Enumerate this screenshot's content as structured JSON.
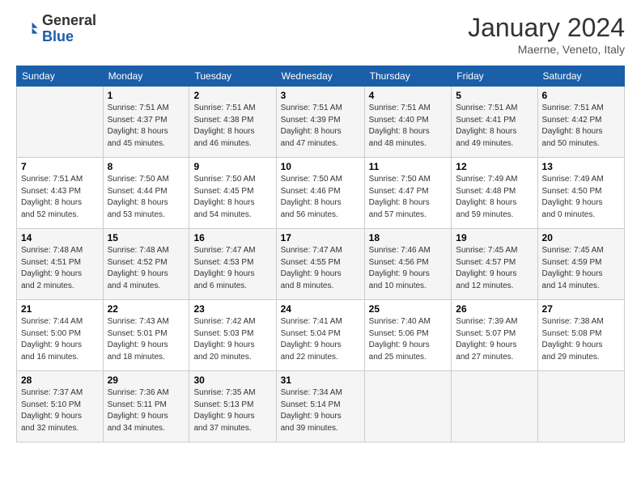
{
  "header": {
    "logo_general": "General",
    "logo_blue": "Blue",
    "month_title": "January 2024",
    "subtitle": "Maerne, Veneto, Italy"
  },
  "weekdays": [
    "Sunday",
    "Monday",
    "Tuesday",
    "Wednesday",
    "Thursday",
    "Friday",
    "Saturday"
  ],
  "weeks": [
    [
      {
        "day": "",
        "info": ""
      },
      {
        "day": "1",
        "info": "Sunrise: 7:51 AM\nSunset: 4:37 PM\nDaylight: 8 hours\nand 45 minutes."
      },
      {
        "day": "2",
        "info": "Sunrise: 7:51 AM\nSunset: 4:38 PM\nDaylight: 8 hours\nand 46 minutes."
      },
      {
        "day": "3",
        "info": "Sunrise: 7:51 AM\nSunset: 4:39 PM\nDaylight: 8 hours\nand 47 minutes."
      },
      {
        "day": "4",
        "info": "Sunrise: 7:51 AM\nSunset: 4:40 PM\nDaylight: 8 hours\nand 48 minutes."
      },
      {
        "day": "5",
        "info": "Sunrise: 7:51 AM\nSunset: 4:41 PM\nDaylight: 8 hours\nand 49 minutes."
      },
      {
        "day": "6",
        "info": "Sunrise: 7:51 AM\nSunset: 4:42 PM\nDaylight: 8 hours\nand 50 minutes."
      }
    ],
    [
      {
        "day": "7",
        "info": "Sunrise: 7:51 AM\nSunset: 4:43 PM\nDaylight: 8 hours\nand 52 minutes."
      },
      {
        "day": "8",
        "info": "Sunrise: 7:50 AM\nSunset: 4:44 PM\nDaylight: 8 hours\nand 53 minutes."
      },
      {
        "day": "9",
        "info": "Sunrise: 7:50 AM\nSunset: 4:45 PM\nDaylight: 8 hours\nand 54 minutes."
      },
      {
        "day": "10",
        "info": "Sunrise: 7:50 AM\nSunset: 4:46 PM\nDaylight: 8 hours\nand 56 minutes."
      },
      {
        "day": "11",
        "info": "Sunrise: 7:50 AM\nSunset: 4:47 PM\nDaylight: 8 hours\nand 57 minutes."
      },
      {
        "day": "12",
        "info": "Sunrise: 7:49 AM\nSunset: 4:48 PM\nDaylight: 8 hours\nand 59 minutes."
      },
      {
        "day": "13",
        "info": "Sunrise: 7:49 AM\nSunset: 4:50 PM\nDaylight: 9 hours\nand 0 minutes."
      }
    ],
    [
      {
        "day": "14",
        "info": "Sunrise: 7:48 AM\nSunset: 4:51 PM\nDaylight: 9 hours\nand 2 minutes."
      },
      {
        "day": "15",
        "info": "Sunrise: 7:48 AM\nSunset: 4:52 PM\nDaylight: 9 hours\nand 4 minutes."
      },
      {
        "day": "16",
        "info": "Sunrise: 7:47 AM\nSunset: 4:53 PM\nDaylight: 9 hours\nand 6 minutes."
      },
      {
        "day": "17",
        "info": "Sunrise: 7:47 AM\nSunset: 4:55 PM\nDaylight: 9 hours\nand 8 minutes."
      },
      {
        "day": "18",
        "info": "Sunrise: 7:46 AM\nSunset: 4:56 PM\nDaylight: 9 hours\nand 10 minutes."
      },
      {
        "day": "19",
        "info": "Sunrise: 7:45 AM\nSunset: 4:57 PM\nDaylight: 9 hours\nand 12 minutes."
      },
      {
        "day": "20",
        "info": "Sunrise: 7:45 AM\nSunset: 4:59 PM\nDaylight: 9 hours\nand 14 minutes."
      }
    ],
    [
      {
        "day": "21",
        "info": "Sunrise: 7:44 AM\nSunset: 5:00 PM\nDaylight: 9 hours\nand 16 minutes."
      },
      {
        "day": "22",
        "info": "Sunrise: 7:43 AM\nSunset: 5:01 PM\nDaylight: 9 hours\nand 18 minutes."
      },
      {
        "day": "23",
        "info": "Sunrise: 7:42 AM\nSunset: 5:03 PM\nDaylight: 9 hours\nand 20 minutes."
      },
      {
        "day": "24",
        "info": "Sunrise: 7:41 AM\nSunset: 5:04 PM\nDaylight: 9 hours\nand 22 minutes."
      },
      {
        "day": "25",
        "info": "Sunrise: 7:40 AM\nSunset: 5:06 PM\nDaylight: 9 hours\nand 25 minutes."
      },
      {
        "day": "26",
        "info": "Sunrise: 7:39 AM\nSunset: 5:07 PM\nDaylight: 9 hours\nand 27 minutes."
      },
      {
        "day": "27",
        "info": "Sunrise: 7:38 AM\nSunset: 5:08 PM\nDaylight: 9 hours\nand 29 minutes."
      }
    ],
    [
      {
        "day": "28",
        "info": "Sunrise: 7:37 AM\nSunset: 5:10 PM\nDaylight: 9 hours\nand 32 minutes."
      },
      {
        "day": "29",
        "info": "Sunrise: 7:36 AM\nSunset: 5:11 PM\nDaylight: 9 hours\nand 34 minutes."
      },
      {
        "day": "30",
        "info": "Sunrise: 7:35 AM\nSunset: 5:13 PM\nDaylight: 9 hours\nand 37 minutes."
      },
      {
        "day": "31",
        "info": "Sunrise: 7:34 AM\nSunset: 5:14 PM\nDaylight: 9 hours\nand 39 minutes."
      },
      {
        "day": "",
        "info": ""
      },
      {
        "day": "",
        "info": ""
      },
      {
        "day": "",
        "info": ""
      }
    ]
  ]
}
